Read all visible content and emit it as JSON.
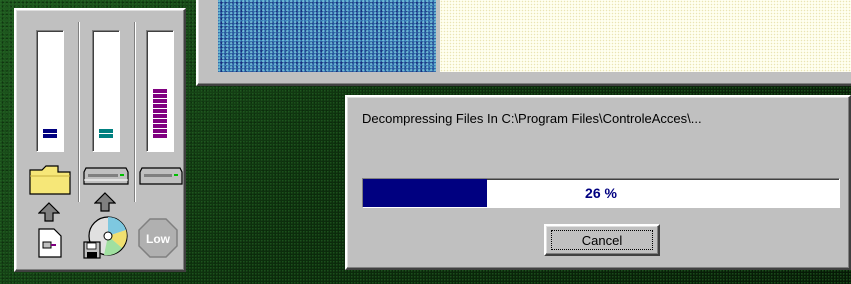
{
  "monitor": {
    "meters": [
      {
        "name": "disk-read",
        "color": "#000080",
        "level": 2,
        "max": 24
      },
      {
        "name": "disk-write",
        "color": "#008080",
        "level": 2,
        "max": 24
      },
      {
        "name": "cpu",
        "color": "#800080",
        "level": 10,
        "max": 24
      }
    ],
    "icons": [
      "folder-icon",
      "drive-icon",
      "drive-icon",
      "arrow-up-icon",
      "arrow-up-icon",
      "document-icon",
      "cd-floppy-icon",
      "low-stop-icon"
    ],
    "low_label": "Low"
  },
  "dialog": {
    "message": "Decompressing Files In C:\\Program Files\\ControleAcces\\...",
    "progress": 0.26,
    "progress_label": "26 %",
    "cancel_label": "Cancel"
  },
  "colors": {
    "progress_fill": "#000080",
    "face": "#c0c0c0"
  }
}
